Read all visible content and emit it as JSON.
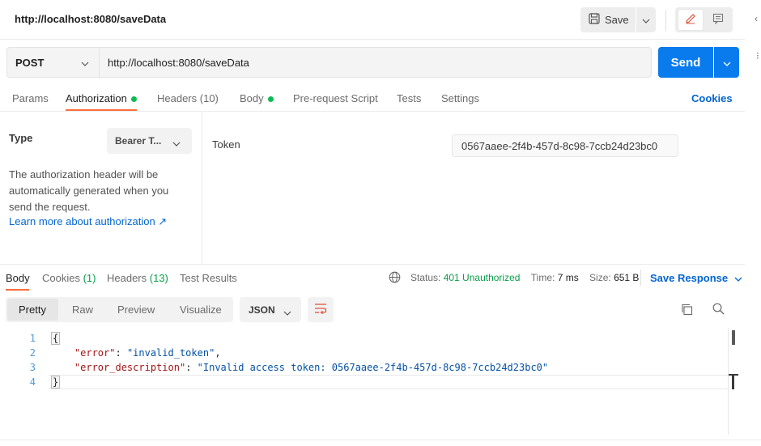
{
  "header": {
    "title": "http://localhost:8080/saveData",
    "save_label": "Save"
  },
  "request": {
    "method": "POST",
    "url": "http://localhost:8080/saveData",
    "send_label": "Send"
  },
  "request_tabs": [
    {
      "label": "Params"
    },
    {
      "label": "Authorization"
    },
    {
      "label": "Headers",
      "count": "(10)"
    },
    {
      "label": "Body"
    },
    {
      "label": "Pre-request Script"
    },
    {
      "label": "Tests"
    },
    {
      "label": "Settings"
    }
  ],
  "cookies_label": "Cookies",
  "auth": {
    "type_label": "Type",
    "type_value": "Bearer T...",
    "description": "The authorization header will be automatically generated when you send the request.",
    "learn_more": "Learn more about authorization ↗",
    "token_label": "Token",
    "token_value": "0567aaee-2f4b-457d-8c98-7ccb24d23bc0"
  },
  "response_tabs": [
    {
      "label": "Body"
    },
    {
      "label": "Cookies",
      "count": "(1)"
    },
    {
      "label": "Headers",
      "count": "(13)"
    },
    {
      "label": "Test Results"
    }
  ],
  "response_meta": {
    "status_label": "Status:",
    "status_value": "401 Unauthorized",
    "time_label": "Time:",
    "time_value": "7 ms",
    "size_label": "Size:",
    "size_value": "651 B",
    "save_response": "Save Response"
  },
  "format_tabs": [
    {
      "label": "Pretty"
    },
    {
      "label": "Raw"
    },
    {
      "label": "Preview"
    },
    {
      "label": "Visualize"
    }
  ],
  "format_select": "JSON",
  "code": {
    "line_numbers": [
      "1",
      "2",
      "3",
      "4"
    ],
    "open_brace": "{",
    "key1": "\"error\"",
    "sep1": ": ",
    "val1": "\"invalid_token\"",
    "comma1": ",",
    "key2": "\"error_description\"",
    "sep2": ": ",
    "val2": "\"Invalid access token: 0567aaee-2f4b-457d-8c98-7ccb24d23bc0\"",
    "close_brace": "}"
  },
  "colors": {
    "accent_blue": "#097bed",
    "active_tab": "#ff6c37",
    "status_green": "#0a9d4a",
    "link_blue": "#0265d2"
  }
}
